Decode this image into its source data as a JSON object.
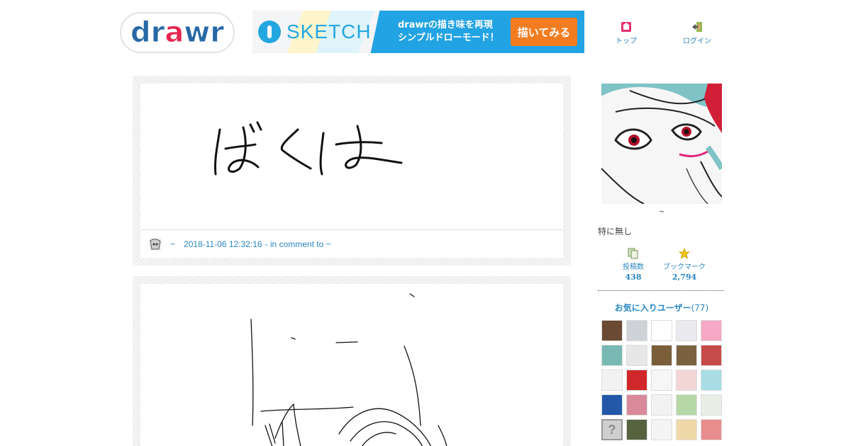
{
  "header": {
    "logo_text": "drawr",
    "banner": {
      "brand": "SKETCH",
      "tagline_line1": "drawrの描き味を再現",
      "tagline_line2": "シンプルドローモード！",
      "cta": "描いてみる"
    },
    "nav": [
      {
        "label": "トップ",
        "icon": "home-icon"
      },
      {
        "label": "ログイン",
        "icon": "login-icon"
      }
    ]
  },
  "posts": [
    {
      "user": "~",
      "timestamp": "2018-11-06 12:32:16",
      "context": "- in comment to ~",
      "drawing_text": "ばくは"
    }
  ],
  "profile": {
    "name": "~",
    "bio": "特に無し",
    "stats": [
      {
        "label": "投稿数",
        "value": "438",
        "icon": "posts-icon"
      },
      {
        "label": "ブックマーク",
        "value": "2,794",
        "icon": "star-icon"
      }
    ],
    "favorites_title": "お気に入りユーザー",
    "favorites_count": "(77)"
  },
  "favorites": [
    {
      "color": "#6b4a33"
    },
    {
      "color": "#cfd3d8"
    },
    {
      "color": "#ffffff"
    },
    {
      "color": "#e9e9ee"
    },
    {
      "color": "#f6a8c4"
    },
    {
      "color": "#79b9b3"
    },
    {
      "color": "#e7e7e7"
    },
    {
      "color": "#7b5f3a"
    },
    {
      "color": "#7a6240"
    },
    {
      "color": "#c64a4a"
    },
    {
      "color": "#f2f2f2"
    },
    {
      "color": "#d0282a"
    },
    {
      "color": "#f6f6f6"
    },
    {
      "color": "#f2d5d5"
    },
    {
      "color": "#a9dde5"
    },
    {
      "color": "#2358a8"
    },
    {
      "color": "#d98a9a"
    },
    {
      "color": "#f2f2f2"
    },
    {
      "color": "#b5d8a6"
    },
    {
      "color": "#e9efe4"
    },
    {
      "color": "#cfcfcf"
    },
    {
      "color": "#55633f"
    },
    {
      "color": "#f4f4f4"
    },
    {
      "color": "#f0d9a8"
    },
    {
      "color": "#e88d8d"
    }
  ]
}
